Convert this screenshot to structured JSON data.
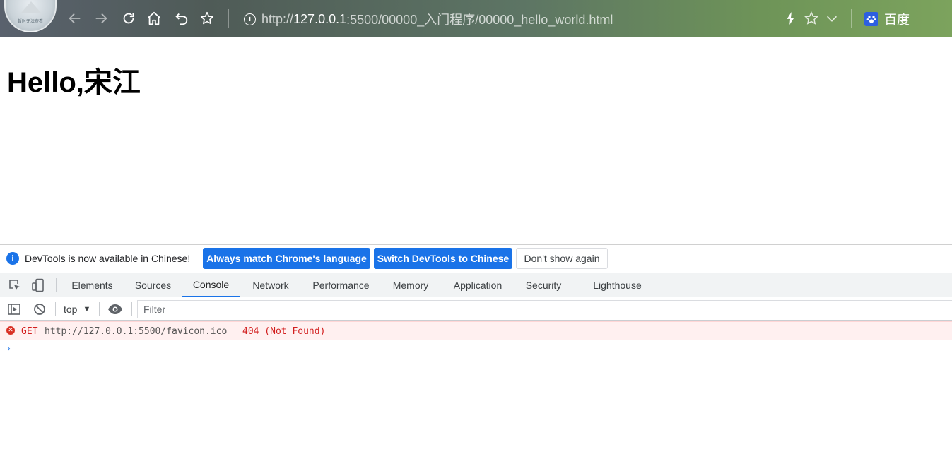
{
  "browser": {
    "avatar_caption": "暂时无法查看",
    "url": {
      "scheme": "http://",
      "host": "127.0.0.1",
      "rest": ":5500/00000_入门程序/00000_hello_world.html"
    },
    "search_engine_label": "百度",
    "icons": [
      "back-icon",
      "forward-icon",
      "reload-icon",
      "home-icon",
      "undo-icon",
      "star-icon",
      "info-icon",
      "lightning-icon",
      "star-icon",
      "chevron-down-icon",
      "baidu-icon"
    ]
  },
  "page": {
    "heading": "Hello,宋江"
  },
  "devtools": {
    "infobar": {
      "message": "DevTools is now available in Chinese!",
      "btn_match": "Always match Chrome's language",
      "btn_switch": "Switch DevTools to Chinese",
      "btn_dismiss": "Don't show again"
    },
    "tabs": [
      "Elements",
      "Sources",
      "Console",
      "Network",
      "Performance",
      "Memory",
      "Application",
      "Security",
      "Lighthouse"
    ],
    "active_tab": "Console",
    "console": {
      "context": "top",
      "filter_placeholder": "Filter",
      "messages": [
        {
          "level": "error",
          "method": "GET",
          "url": "http://127.0.0.1:5500/favicon.ico",
          "status": "404 (Not Found)"
        }
      ],
      "prompt_symbol": "›"
    },
    "colors": {
      "accent": "#1a73e8",
      "error_bg": "#fff0f0",
      "error_text": "#d21f1f"
    }
  }
}
